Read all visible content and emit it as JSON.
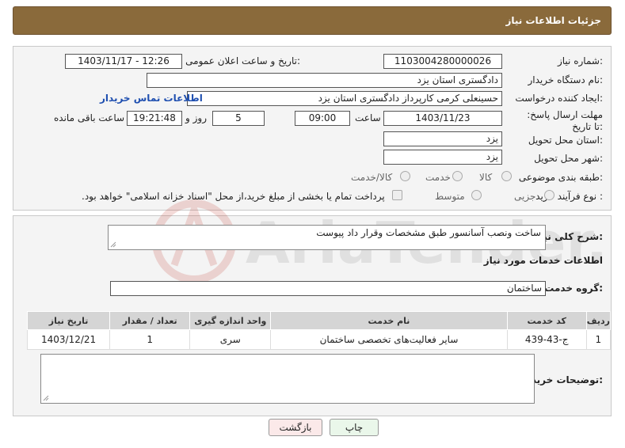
{
  "header": {
    "title": "جزئیات اطلاعات نیاز"
  },
  "form": {
    "need_number_label": "شماره نیاز:",
    "need_number": "1103004280000026",
    "announce_label": "تاریخ و ساعت اعلان عمومی:",
    "announce_value": "1403/11/17 - 12:26",
    "buyer_org_label": "نام دستگاه خریدار:",
    "buyer_org": "دادگستری استان یزد",
    "creator_label": "ایجاد کننده درخواست:",
    "creator": "حسینعلی کرمی کارپرداز دادگستری استان یزد",
    "contact_link": "اطلاعات تماس خریدار",
    "deadline_label": "مهلت ارسال پاسخ: تا تاریخ:",
    "deadline_date": "1403/11/23",
    "time_label": "ساعت",
    "deadline_time": "09:00",
    "days_value": "5",
    "days_label": "روز و",
    "remaining_time": "19:21:48",
    "remaining_label": "ساعت باقی مانده",
    "province_label": "استان محل تحویل:",
    "province": "یزد",
    "city_label": "شهر محل تحویل:",
    "city": "یزد",
    "category_label": "طبقه بندی موضوعی:",
    "category_options": [
      "کالا",
      "خدمت",
      "کالا/خدمت"
    ],
    "process_label": "نوع فرآیند خرید :",
    "process_options": [
      "جزیی",
      "متوسط"
    ],
    "payment_note": "پرداخت تمام یا بخشی از مبلغ خرید،از محل \"اسناد خزانه اسلامی\" خواهد بود."
  },
  "details": {
    "summary_label": "شرح کلی نیاز:",
    "summary": "ساخت ونصب آسانسور طبق مشخصات وقرار داد پیوست",
    "services_title": "اطلاعات خدمات مورد نیاز",
    "service_group_label": "گروه خدمت:",
    "service_group": "ساختمان",
    "table": {
      "headers": [
        "ردیف",
        "کد خدمت",
        "نام خدمت",
        "واحد اندازه گیری",
        "تعداد / مقدار",
        "تاریخ نیاز"
      ],
      "rows": [
        [
          "1",
          "ج-43-439",
          "سایر فعالیت‌های تخصصی ساختمان",
          "سری",
          "1",
          "1403/12/21"
        ]
      ]
    },
    "buyer_notes_label": "توضیحات خریدار:",
    "buyer_notes": ""
  },
  "buttons": {
    "print": "چاپ",
    "back": "بازگشت"
  },
  "watermark": {
    "text": "AriaTender.neT"
  },
  "colors": {
    "header_bg": "#8a6a3b",
    "link": "#1f4fb0",
    "watermark": "#c0392b"
  }
}
